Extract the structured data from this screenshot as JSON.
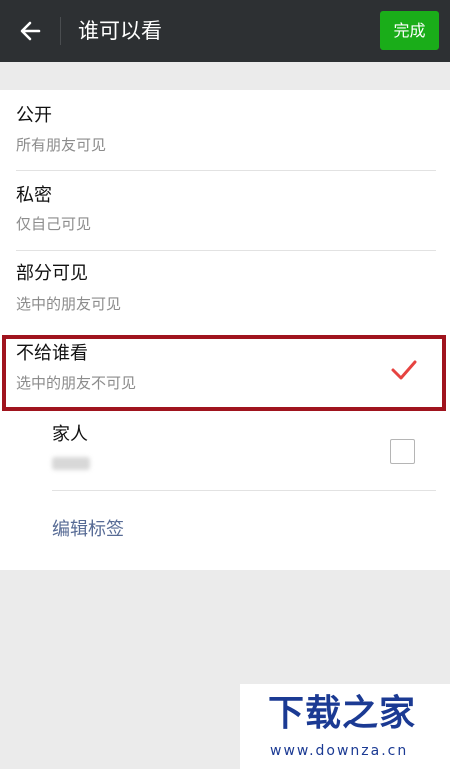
{
  "header": {
    "back_icon": "arrow-left-icon",
    "title": "谁可以看",
    "done_label": "完成",
    "done_color": "#1aad19",
    "bar_color": "#2d3033"
  },
  "options": [
    {
      "title": "公开",
      "desc": "所有朋友可见"
    },
    {
      "title": "私密",
      "desc": "仅自己可见"
    },
    {
      "title": "部分可见",
      "desc": "选中的朋友可见"
    },
    {
      "title": "不给谁看",
      "desc": "选中的朋友不可见",
      "selected": true
    }
  ],
  "tag_list": {
    "items": [
      {
        "name": "家人",
        "checked": false
      }
    ],
    "edit_label": "编辑标签"
  },
  "highlight_color": "#a0141e",
  "check_color": "#e64340",
  "link_color": "#576b95",
  "watermark": {
    "brand": "下载之家",
    "url": "www.downza.cn"
  }
}
